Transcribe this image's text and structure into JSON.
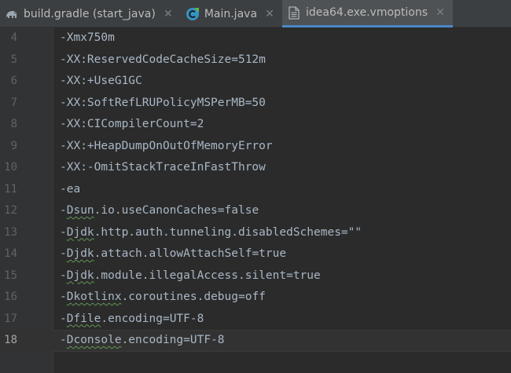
{
  "tabs": [
    {
      "label": "build.gradle (start_java)",
      "icon": "gradle-elephant-icon",
      "active": false
    },
    {
      "label": "Main.java",
      "icon": "java-class-icon",
      "active": false
    },
    {
      "label": "idea64.exe.vmoptions",
      "icon": "text-file-icon",
      "active": true
    }
  ],
  "colors": {
    "editor_bg": "#2b2b2b",
    "gutter_bg": "#313335",
    "text": "#a9b7c6",
    "line_number": "#606366",
    "active_tab_underline": "#4a88c7"
  },
  "editor": {
    "current_line": "18",
    "lines": [
      {
        "num": "4",
        "pre": "-Xmx750m",
        "sq": "",
        "post": ""
      },
      {
        "num": "5",
        "pre": "-XX:ReservedCodeCacheSize=512m",
        "sq": "",
        "post": ""
      },
      {
        "num": "6",
        "pre": "-XX:+UseG1GC",
        "sq": "",
        "post": ""
      },
      {
        "num": "7",
        "pre": "-XX:SoftRefLRUPolicyMSPerMB=50",
        "sq": "",
        "post": ""
      },
      {
        "num": "8",
        "pre": "-XX:CICompilerCount=2",
        "sq": "",
        "post": ""
      },
      {
        "num": "9",
        "pre": "-XX:+HeapDumpOnOutOfMemoryError",
        "sq": "",
        "post": ""
      },
      {
        "num": "10",
        "pre": "-XX:-OmitStackTraceInFastThrow",
        "sq": "",
        "post": ""
      },
      {
        "num": "11",
        "pre": "-ea",
        "sq": "",
        "post": ""
      },
      {
        "num": "12",
        "pre": "-",
        "sq": "Dsun",
        "post": ".io.useCanonCaches=false"
      },
      {
        "num": "13",
        "pre": "-",
        "sq": "Djdk",
        "post": ".http.auth.tunneling.disabledSchemes=\"\""
      },
      {
        "num": "14",
        "pre": "-",
        "sq": "Djdk",
        "post": ".attach.allowAttachSelf=true"
      },
      {
        "num": "15",
        "pre": "-",
        "sq": "Djdk",
        "post": ".module.illegalAccess.silent=true"
      },
      {
        "num": "16",
        "pre": "-",
        "sq": "Dkotlinx",
        "post": ".coroutines.debug=off"
      },
      {
        "num": "17",
        "pre": "-",
        "sq": "Dfile",
        "post": ".encoding=UTF-8"
      },
      {
        "num": "18",
        "pre": "-",
        "sq": "Dconsole",
        "post": ".encoding=UTF-8"
      }
    ]
  }
}
